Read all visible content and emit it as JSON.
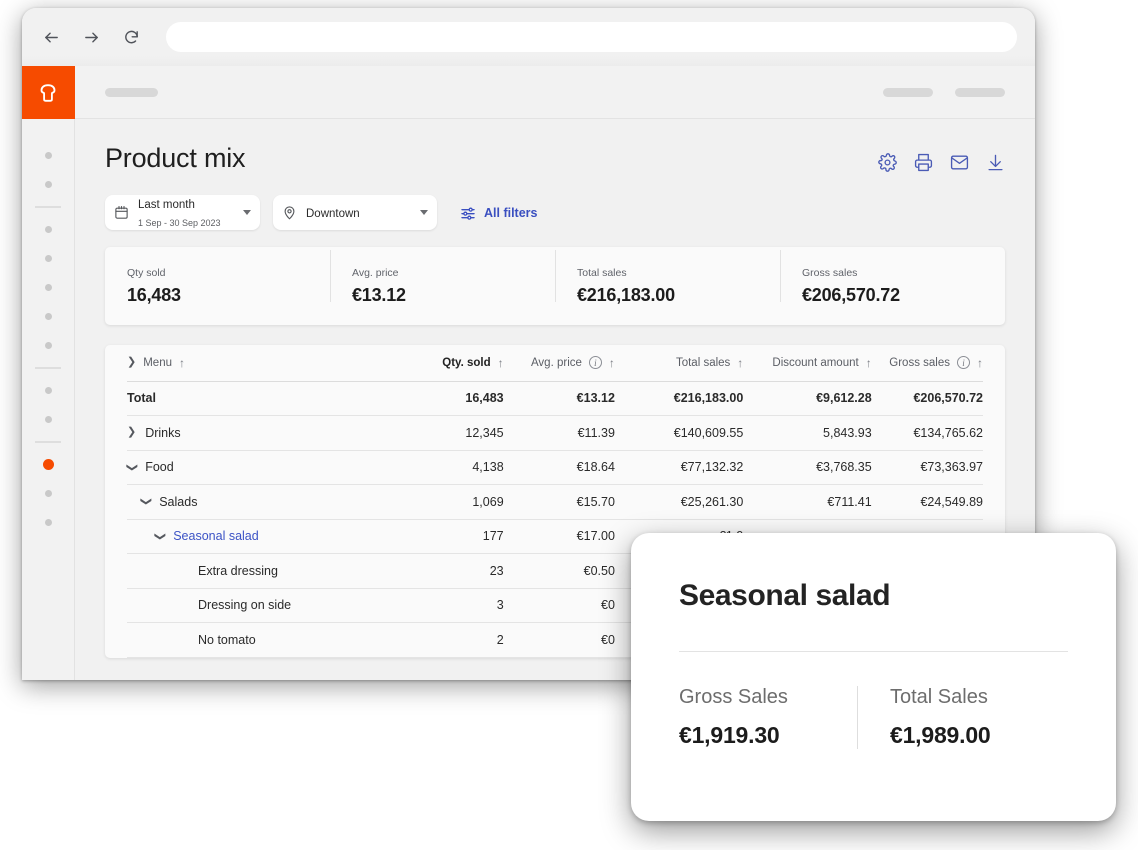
{
  "browser": {
    "back_icon": "arrow-left-icon",
    "forward_icon": "arrow-right-icon",
    "reload_icon": "reload-icon",
    "url_value": "",
    "url_placeholder": ""
  },
  "app": {
    "logo_name": "toast-logo",
    "brand_color": "#f64b00",
    "accent_color": "#3a4fc0",
    "sidebar": {
      "items": [
        {
          "name": "nav-dot-1",
          "active": false
        },
        {
          "name": "nav-dot-2",
          "active": false
        },
        {
          "name": "nav-separator-1",
          "separator": true
        },
        {
          "name": "nav-dot-3",
          "active": false
        },
        {
          "name": "nav-dot-4",
          "active": false
        },
        {
          "name": "nav-dot-5",
          "active": false
        },
        {
          "name": "nav-dot-6",
          "active": false
        },
        {
          "name": "nav-dot-7",
          "active": false
        },
        {
          "name": "nav-separator-2",
          "separator": true
        },
        {
          "name": "nav-dot-8",
          "active": false
        },
        {
          "name": "nav-dot-9",
          "active": false
        },
        {
          "name": "nav-separator-3",
          "separator": true
        },
        {
          "name": "nav-dot-10",
          "active": true
        },
        {
          "name": "nav-dot-11",
          "active": false
        },
        {
          "name": "nav-dot-12",
          "active": false
        }
      ]
    }
  },
  "header": {
    "title": "Product mix",
    "actions": [
      {
        "name": "settings-icon",
        "label": "Settings"
      },
      {
        "name": "print-icon",
        "label": "Print"
      },
      {
        "name": "email-icon",
        "label": "Email"
      },
      {
        "name": "download-icon",
        "label": "Download"
      }
    ]
  },
  "filters": {
    "date": {
      "icon": "calendar-icon",
      "main": "Last month",
      "sub": "1 Sep - 30 Sep 2023"
    },
    "location": {
      "icon": "location-pin-icon",
      "main": "Downtown"
    },
    "all_filters": {
      "icon": "filter-sliders-icon",
      "label": "All filters"
    }
  },
  "kpis": [
    {
      "label": "Qty sold",
      "value": "16,483"
    },
    {
      "label": "Avg. price",
      "value": "€13.12"
    },
    {
      "label": "Total sales",
      "value": "€216,183.00"
    },
    {
      "label": "Gross sales",
      "value": "€206,570.72"
    }
  ],
  "table": {
    "columns": [
      {
        "key": "menu",
        "label": "Menu",
        "align": "left",
        "sortable": true,
        "info": false
      },
      {
        "key": "qty",
        "label": "Qty. sold",
        "align": "right",
        "sortable": true,
        "info": false,
        "bold": true
      },
      {
        "key": "avg",
        "label": "Avg. price",
        "align": "right",
        "sortable": true,
        "info": true
      },
      {
        "key": "tot",
        "label": "Total sales",
        "align": "right",
        "sortable": true,
        "info": false
      },
      {
        "key": "dis",
        "label": "Discount amount",
        "align": "right",
        "sortable": true,
        "info": false
      },
      {
        "key": "gro",
        "label": "Gross sales",
        "align": "right",
        "sortable": true,
        "info": true
      }
    ],
    "sort_icon": "↑",
    "rows": [
      {
        "name": "row-total",
        "label": "Total",
        "indent": 1,
        "chevron": "",
        "link": false,
        "bold": true,
        "qty": "16,483",
        "avg": "€13.12",
        "tot": "€216,183.00",
        "dis": "€9,612.28",
        "gro": "€206,570.72"
      },
      {
        "name": "row-drinks",
        "label": "Drinks",
        "indent": 1,
        "chevron": "right",
        "link": false,
        "bold": false,
        "qty": "12,345",
        "avg": "€11.39",
        "tot": "€140,609.55",
        "dis": "5,843.93",
        "gro": "€134,765.62"
      },
      {
        "name": "row-food",
        "label": "Food",
        "indent": 1,
        "chevron": "down",
        "link": false,
        "bold": false,
        "qty": "4,138",
        "avg": "€18.64",
        "tot": "€77,132.32",
        "dis": "€3,768.35",
        "gro": "€73,363.97"
      },
      {
        "name": "row-salads",
        "label": "Salads",
        "indent": 2,
        "chevron": "down",
        "link": false,
        "bold": false,
        "qty": "1,069",
        "avg": "€15.70",
        "tot": "€25,261.30",
        "dis": "€711.41",
        "gro": "€24,549.89"
      },
      {
        "name": "row-seasonal-salad",
        "label": "Seasonal salad",
        "indent": 3,
        "chevron": "down",
        "link": true,
        "bold": false,
        "qty": "177",
        "avg": "€17.00",
        "tot": "€1,9",
        "dis": "",
        "gro": ""
      },
      {
        "name": "row-extra-dressing",
        "label": "Extra dressing",
        "indent": 4,
        "chevron": "",
        "link": false,
        "bold": false,
        "qty": "23",
        "avg": "€0.50",
        "tot": "",
        "dis": "",
        "gro": ""
      },
      {
        "name": "row-dressing-on-side",
        "label": "Dressing on side",
        "indent": 4,
        "chevron": "",
        "link": false,
        "bold": false,
        "qty": "3",
        "avg": "€0",
        "tot": "",
        "dis": "",
        "gro": ""
      },
      {
        "name": "row-no-tomato",
        "label": "No tomato",
        "indent": 4,
        "chevron": "",
        "link": false,
        "bold": false,
        "qty": "2",
        "avg": "€0",
        "tot": "",
        "dis": "",
        "gro": ""
      }
    ]
  },
  "popup": {
    "title": "Seasonal salad",
    "stats": [
      {
        "label": "Gross Sales",
        "value": "€1,919.30"
      },
      {
        "label": "Total Sales",
        "value": "€1,989.00"
      }
    ]
  }
}
